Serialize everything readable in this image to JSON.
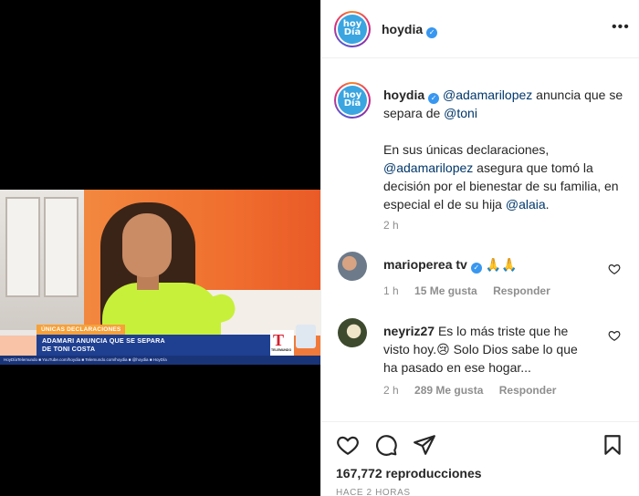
{
  "video": {
    "lower_third_tag": "ÚNICAS DECLARACIONES",
    "lower_third_headline_1": "ADAMARI ANUNCIA QUE SE SEPARA",
    "lower_third_headline_2": "DE TONI COSTA",
    "network_logo_letter": "T",
    "network_logo_name": "TELEMUNDO",
    "ticker": "HoyDíaTelemundo   ■ YouTube.com/hoydia   ■ Telemundo.com/hoydia   ■ @hoydia   ■ HoyDía"
  },
  "header": {
    "avatar_text_1": "hoy",
    "avatar_text_2": "Día",
    "username": "hoydia",
    "verified_mark": "✓",
    "more_icon": "•••"
  },
  "caption": {
    "username": "hoydia",
    "mention_1": "@adamarilopez",
    "text_1": " anuncia que se separa de ",
    "mention_2": "@toni",
    "para2_text_1": "En sus únicas declaraciones, ",
    "para2_mention_1": "@adamarilopez",
    "para2_text_2": " asegura que tomó la decisión por el bienestar de su familia, en especial el de su hija ",
    "para2_mention_2": "@alaia",
    "para2_text_3": ".",
    "time": "2 h"
  },
  "comments": [
    {
      "username": "marioperea tv",
      "text": "🙏🙏",
      "time": "1 h",
      "likes": "15 Me gusta",
      "reply": "Responder"
    },
    {
      "username": "neyriz27",
      "text": "Es lo más triste que he visto hoy.😢 Solo Dios sabe lo que ha pasado en ese hogar...",
      "time": "2 h",
      "likes": "289 Me gusta",
      "reply": "Responder"
    }
  ],
  "actions": {
    "views": "167,772 reproducciones",
    "time_ago": "HACE 2 HORAS"
  },
  "colors": {
    "link": "#00376b",
    "verified": "#3897f0",
    "muted": "#8e8e8e"
  }
}
